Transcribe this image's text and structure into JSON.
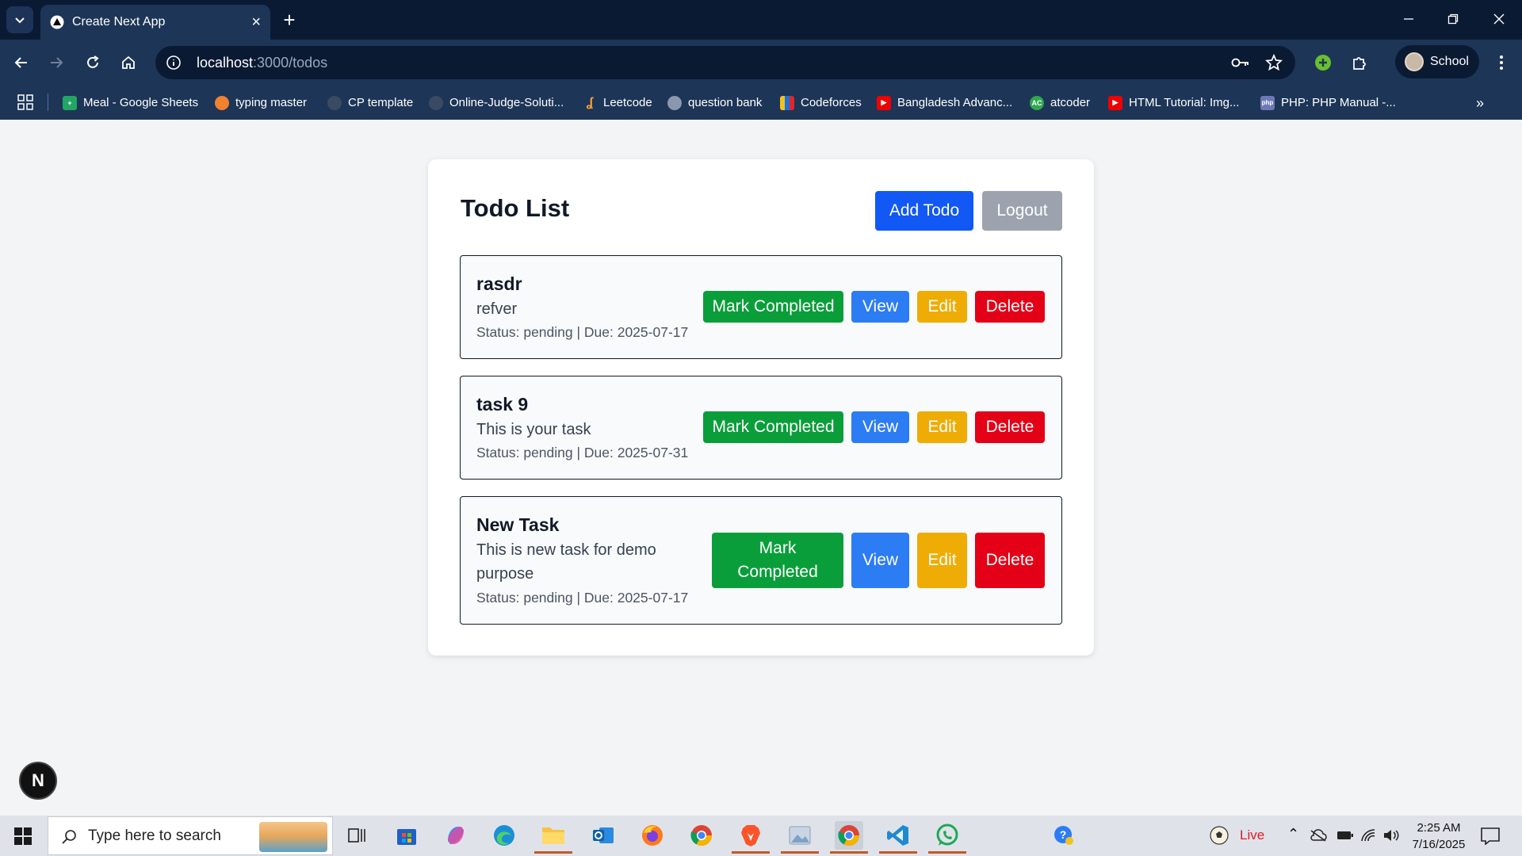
{
  "browser": {
    "tab_title": "Create Next App",
    "url_host": "localhost",
    "url_path": ":3000/todos",
    "profile_name": "School",
    "bookmarks": [
      {
        "label": "Meal - Google Sheets",
        "icon": "sheets-icon",
        "color": "#22a565"
      },
      {
        "label": "typing master",
        "icon": "typing-icon",
        "color": "#f0812f"
      },
      {
        "label": "CP template",
        "icon": "github-icon",
        "color": "#3a4a63"
      },
      {
        "label": "Online-Judge-Soluti...",
        "icon": "github-icon",
        "color": "#3a4a63"
      },
      {
        "label": "Leetcode",
        "icon": "leetcode-icon",
        "color": "#f4a235"
      },
      {
        "label": "question bank",
        "icon": "globe-icon",
        "color": "#8a97ac"
      },
      {
        "label": "Codeforces",
        "icon": "codeforces-icon",
        "color": "#f2c21a"
      },
      {
        "label": "Bangladesh Advanc...",
        "icon": "youtube-icon",
        "color": "#f00000"
      },
      {
        "label": "atcoder",
        "icon": "atcoder-icon",
        "color": "#2fa84f"
      },
      {
        "label": "HTML Tutorial: Img...",
        "icon": "youtube-icon",
        "color": "#f00000"
      },
      {
        "label": "PHP: PHP Manual -...",
        "icon": "php-icon",
        "color": "#6d78b6"
      }
    ]
  },
  "page": {
    "title": "Todo List",
    "add_label": "Add Todo",
    "logout_label": "Logout",
    "todos": [
      {
        "title": "rasdr",
        "description": "refver",
        "status_line": "Status: pending | Due: 2025-07-17",
        "complete_label": "Mark Completed",
        "view_label": "View",
        "edit_label": "Edit",
        "delete_label": "Delete"
      },
      {
        "title": "task 9",
        "description": "This is your task",
        "status_line": "Status: pending | Due: 2025-07-31",
        "complete_label": "Mark Completed",
        "view_label": "View",
        "edit_label": "Edit",
        "delete_label": "Delete"
      },
      {
        "title": "New Task",
        "description": "This is new task for demo purpose",
        "status_line": "Status: pending | Due: 2025-07-17",
        "complete_label": "Mark Completed",
        "view_label": "View",
        "edit_label": "Edit",
        "delete_label": "Delete"
      }
    ],
    "dev_badge": "N"
  },
  "taskbar": {
    "search_placeholder": "Type here to search",
    "weather_label": "Live",
    "time": "2:25 AM",
    "date": "7/16/2025"
  },
  "colors": {
    "primary": "#1158f5",
    "success": "#0a9e3a",
    "info": "#2c7cf4",
    "warning": "#eeac05",
    "danger": "#e40016",
    "muted": "#9ca3af"
  }
}
